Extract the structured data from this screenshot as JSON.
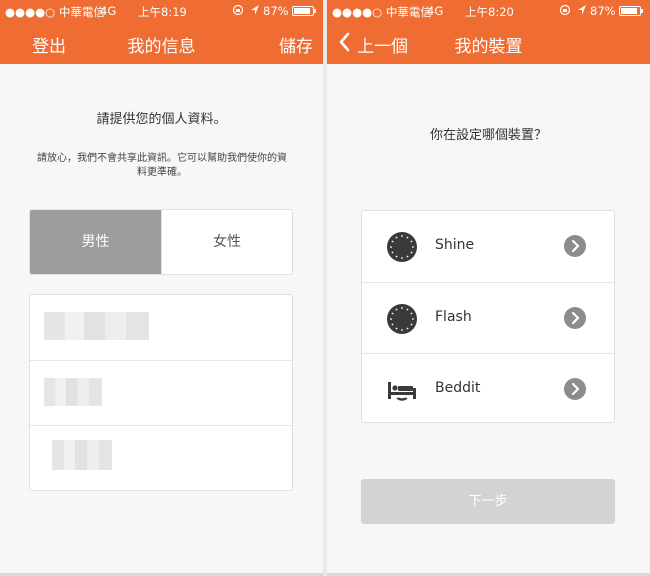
{
  "left": {
    "status": {
      "carrier": "●●●●○ 中華電信",
      "network": "4G",
      "time": "上午8:19",
      "lock_icon": "rotation-lock-icon",
      "location_icon": "location-arrow-icon",
      "battery": "87%",
      "battery_level": 0.87
    },
    "nav": {
      "left_label": "登出",
      "title": "我的信息",
      "right_label": "儲存"
    },
    "prompt": "請提供您的個人資料。",
    "note": "請放心，我們不會共享此資訊。它可以幫助我們使你的資料更準確。",
    "gender": {
      "male": "男性",
      "female": "女性",
      "selected": "男性"
    }
  },
  "right": {
    "status": {
      "carrier": "●●●●○ 中華電信",
      "network": "4G",
      "time": "上午8:20",
      "lock_icon": "rotation-lock-icon",
      "location_icon": "location-arrow-icon",
      "battery": "87%",
      "battery_level": 0.87
    },
    "nav": {
      "back_label": "上一個",
      "title": "我的裝置",
      "back_icon": "chevron-left-icon"
    },
    "question": "你在設定哪個裝置？",
    "devices": [
      {
        "label": "Shine",
        "icon": "shine-device-icon"
      },
      {
        "label": "Flash",
        "icon": "flash-device-icon"
      },
      {
        "label": "Beddit",
        "icon": "beddit-bed-icon"
      }
    ],
    "next_label": "下一步"
  },
  "colors": {
    "accent": "#ef6d33",
    "selected_segment": "#9d9d9d",
    "disabled_button": "#d3d3d3",
    "chevron_badge": "#8c8c8c"
  }
}
